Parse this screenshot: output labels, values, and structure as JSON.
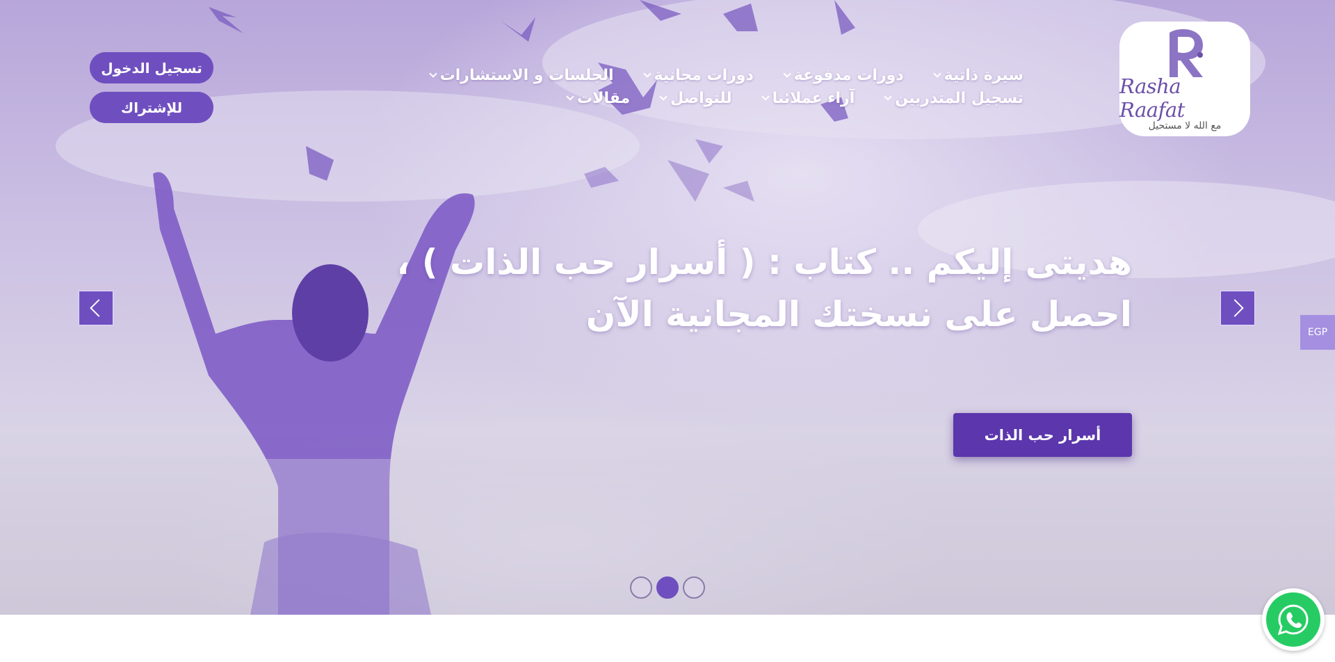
{
  "colors": {
    "primary": "#6f4fbf",
    "cta": "#5b36ac",
    "currency_tab": "#a48fe0",
    "whatsapp": "#26cc63"
  },
  "header": {
    "logo": {
      "brand": "Rasha Raafat",
      "tagline": "مع الله لا مستحيل",
      "icon": "logo-r-icon"
    },
    "nav": [
      {
        "label": "سيرة ذاتية",
        "has_dropdown": true
      },
      {
        "label": "دورات مدفوعة",
        "has_dropdown": true
      },
      {
        "label": "دورات مجانية",
        "has_dropdown": true
      },
      {
        "label": "الجلسات و الاستشارات",
        "has_dropdown": true
      },
      {
        "label": "تسجيل المتدربين",
        "has_dropdown": true
      },
      {
        "label": "آراء عملائنا",
        "has_dropdown": true
      },
      {
        "label": "للتواصل",
        "has_dropdown": true
      },
      {
        "label": "مقالات",
        "has_dropdown": true
      }
    ],
    "login_label": "تسجيل الدخول",
    "subscribe_label": "للإشتراك"
  },
  "slider": {
    "headline_line1": "هديتى إليكم .. كتاب : ( أسرار حب الذات ) ،",
    "headline_line2": "احصل على نسختك المجانية الآن",
    "cta_label": "أسرار حب الذات",
    "prev_icon": "chevron-left-icon",
    "next_icon": "chevron-right-icon",
    "dots": {
      "count": 3,
      "active_index": 1
    }
  },
  "currency": "EGP",
  "whatsapp_icon": "whatsapp-icon"
}
